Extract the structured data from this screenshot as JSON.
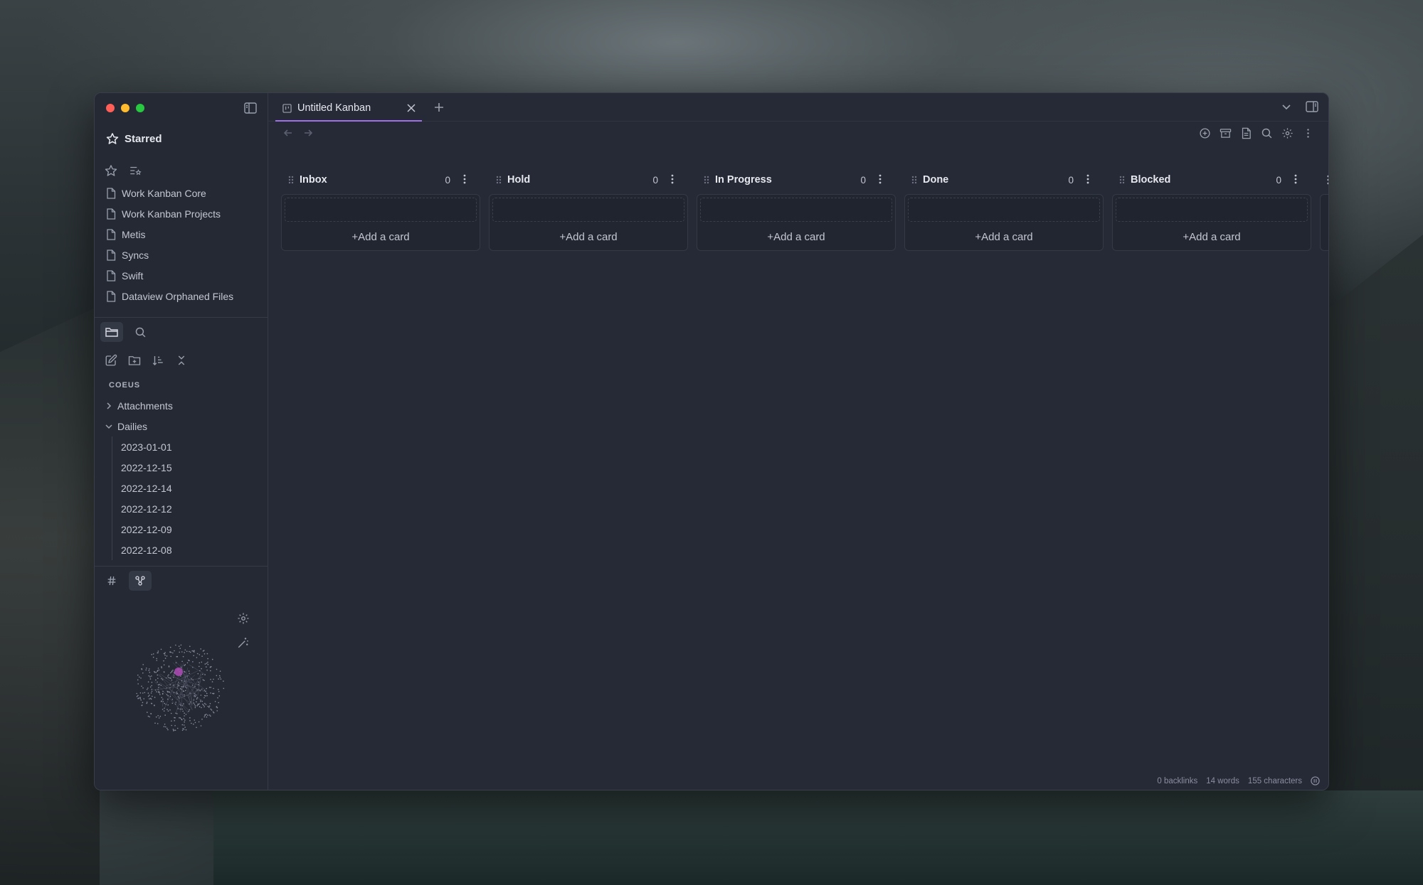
{
  "window": {
    "traffic_lights": [
      "close",
      "minimize",
      "zoom"
    ],
    "accent_color": "#a070e8"
  },
  "sidebar": {
    "starred_title": "Starred",
    "starred_items": [
      {
        "label": "Work Kanban Core",
        "icon": "file-icon"
      },
      {
        "label": "Work Kanban Projects",
        "icon": "file-icon"
      },
      {
        "label": "Metis",
        "icon": "file-icon"
      },
      {
        "label": "Syncs",
        "icon": "file-icon"
      },
      {
        "label": "Swift",
        "icon": "file-icon"
      },
      {
        "label": "Dataview Orphaned Files",
        "icon": "file-icon"
      }
    ],
    "vault_name": "COEUS",
    "folders": [
      {
        "label": "Attachments",
        "expanded": false
      },
      {
        "label": "Dailies",
        "expanded": true
      }
    ],
    "daily_notes": [
      "2023-01-01",
      "2022-12-15",
      "2022-12-14",
      "2022-12-12",
      "2022-12-09",
      "2022-12-08"
    ]
  },
  "tabs": [
    {
      "title": "Untitled Kanban",
      "active": true
    }
  ],
  "board": {
    "lanes": [
      {
        "title": "Inbox",
        "count": "0",
        "add_label": "+Add a card"
      },
      {
        "title": "Hold",
        "count": "0",
        "add_label": "+Add a card"
      },
      {
        "title": "In Progress",
        "count": "0",
        "add_label": "+Add a card"
      },
      {
        "title": "Done",
        "count": "0",
        "add_label": "+Add a card"
      },
      {
        "title": "Blocked",
        "count": "0",
        "add_label": "+Add a card"
      }
    ]
  },
  "status": {
    "backlinks": "0 backlinks",
    "words": "14 words",
    "characters": "155 characters"
  }
}
